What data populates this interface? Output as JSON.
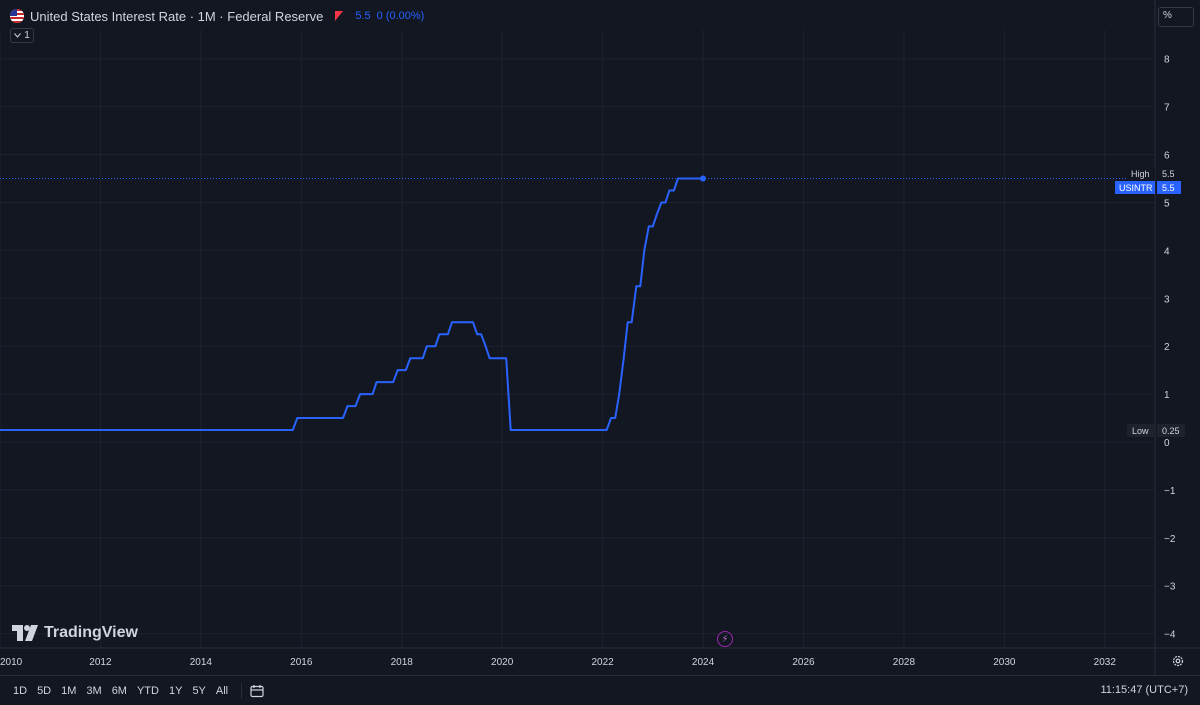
{
  "header": {
    "title": "United States Interest Rate · 1M · Federal Reserve",
    "value": "5.5",
    "change": "0 (0.00%)",
    "collapse_label": "1",
    "percent_label": "%"
  },
  "labels": {
    "high_label": "High",
    "high_value": "5.5",
    "symbol_label": "USINTR",
    "symbol_value": "5.5",
    "low_label": "Low",
    "low_value": "0.25"
  },
  "logo_text": "TradingView",
  "bottombar": {
    "ranges": [
      "1D",
      "5D",
      "1M",
      "3M",
      "6M",
      "YTD",
      "1Y",
      "5Y",
      "All"
    ],
    "clock": "11:15:47 (UTC+7)"
  },
  "colors": {
    "background": "#131722",
    "line": "#2962ff",
    "grid": "#1e222d",
    "text": "#d1d4dc"
  },
  "icons": [
    "us-flag-icon",
    "flag-marker-icon",
    "chevron-down-icon",
    "tradingview-logo-icon",
    "lightning-icon",
    "calendar-icon",
    "settings-gear-icon"
  ],
  "chart_data": {
    "type": "line",
    "title": "United States Interest Rate · 1M · Federal Reserve",
    "xlabel": "",
    "ylabel": "",
    "xlim": [
      2010.0,
      2033.0
    ],
    "ylim": [
      -4.3,
      8.6
    ],
    "x_ticks": [
      "2010",
      "2012",
      "2014",
      "2016",
      "2018",
      "2020",
      "2022",
      "2024",
      "2026",
      "2028",
      "2030",
      "2032"
    ],
    "y_ticks": [
      "8",
      "7",
      "6",
      "5",
      "4",
      "3",
      "2",
      "1",
      "0",
      "−1",
      "−2",
      "−3",
      "−4"
    ],
    "y_tick_values": [
      8,
      7,
      6,
      5,
      4,
      3,
      2,
      1,
      0,
      -1,
      -2,
      -3,
      -4
    ],
    "grid": true,
    "high": 5.5,
    "low": 0.25,
    "series": [
      {
        "points": [
          [
            2010.0,
            0.25
          ],
          [
            2015.83,
            0.25
          ],
          [
            2015.92,
            0.5
          ],
          [
            2016.83,
            0.5
          ],
          [
            2016.92,
            0.75
          ],
          [
            2017.08,
            0.75
          ],
          [
            2017.17,
            1.0
          ],
          [
            2017.42,
            1.0
          ],
          [
            2017.5,
            1.25
          ],
          [
            2017.83,
            1.25
          ],
          [
            2017.92,
            1.5
          ],
          [
            2018.08,
            1.5
          ],
          [
            2018.17,
            1.75
          ],
          [
            2018.42,
            1.75
          ],
          [
            2018.5,
            2.0
          ],
          [
            2018.67,
            2.0
          ],
          [
            2018.75,
            2.25
          ],
          [
            2018.92,
            2.25
          ],
          [
            2019.0,
            2.5
          ],
          [
            2019.42,
            2.5
          ],
          [
            2019.5,
            2.25
          ],
          [
            2019.58,
            2.25
          ],
          [
            2019.67,
            2.0
          ],
          [
            2019.75,
            1.75
          ],
          [
            2020.08,
            1.75
          ],
          [
            2020.17,
            0.25
          ],
          [
            2022.08,
            0.25
          ],
          [
            2022.17,
            0.5
          ],
          [
            2022.25,
            0.5
          ],
          [
            2022.33,
            1.0
          ],
          [
            2022.42,
            1.75
          ],
          [
            2022.5,
            2.5
          ],
          [
            2022.58,
            2.5
          ],
          [
            2022.67,
            3.25
          ],
          [
            2022.75,
            3.25
          ],
          [
            2022.83,
            4.0
          ],
          [
            2022.92,
            4.5
          ],
          [
            2023.0,
            4.5
          ],
          [
            2023.08,
            4.75
          ],
          [
            2023.17,
            5.0
          ],
          [
            2023.25,
            5.0
          ],
          [
            2023.33,
            5.25
          ],
          [
            2023.42,
            5.25
          ],
          [
            2023.5,
            5.5
          ],
          [
            2024.0,
            5.5
          ]
        ]
      }
    ]
  }
}
